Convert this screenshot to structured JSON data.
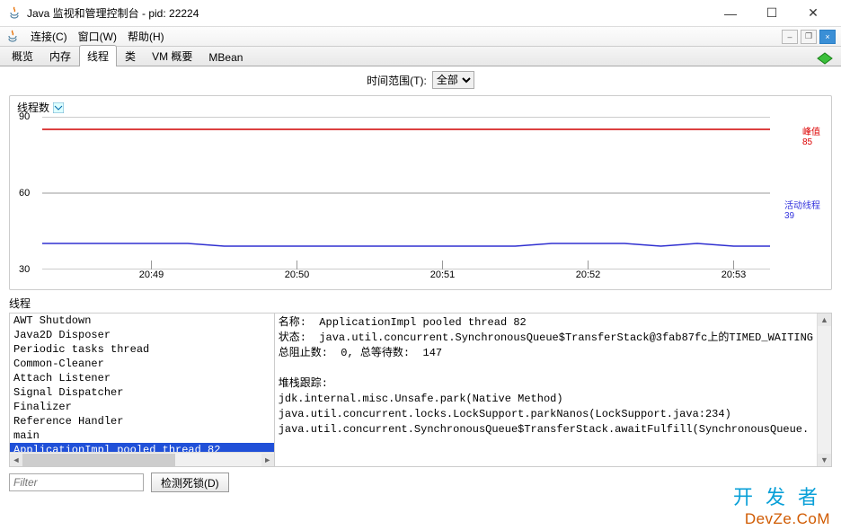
{
  "window": {
    "title": "Java 监视和管理控制台 - pid: 22224"
  },
  "menu": {
    "connect": "连接(C)",
    "window": "窗口(W)",
    "help": "帮助(H)"
  },
  "tabs": {
    "overview": "概览",
    "memory": "内存",
    "threads": "线程",
    "classes": "类",
    "vm": "VM 概要",
    "mbean": "MBean",
    "active": "threads"
  },
  "range": {
    "label": "时间范围(T):",
    "selected": "全部",
    "options": [
      "全部"
    ]
  },
  "chart_data": {
    "type": "line",
    "title": "线程数",
    "xlabel": "",
    "ylabel": "",
    "ylim": [
      30,
      90
    ],
    "yticks": [
      30,
      60,
      90
    ],
    "xticks": [
      "20:49",
      "20:50",
      "20:51",
      "20:52",
      "20:53"
    ],
    "series": [
      {
        "name": "峰值",
        "value_label": "85",
        "color": "#d00000",
        "values": [
          85,
          85,
          85,
          85,
          85,
          85,
          85,
          85,
          85,
          85,
          85,
          85,
          85,
          85,
          85,
          85,
          85,
          85,
          85,
          85
        ]
      },
      {
        "name": "活动线程",
        "value_label": "39",
        "color": "#3030d0",
        "values": [
          40,
          40,
          40,
          40,
          40,
          40,
          39,
          39,
          39,
          39,
          39,
          39,
          39,
          40,
          40,
          39,
          40,
          40,
          39,
          39
        ]
      }
    ]
  },
  "threads_section_label": "线程",
  "thread_list": {
    "items": [
      "AWT Shutdown",
      "Java2D Disposer",
      "Periodic tasks thread",
      "Common-Cleaner",
      "Attach Listener",
      "Signal Dispatcher",
      "Finalizer",
      "Reference Handler",
      "main",
      "ApplicationImpl pooled thread 82"
    ],
    "selected_index": 9
  },
  "detail": {
    "name_label": "名称:",
    "name_value": "ApplicationImpl pooled thread 82",
    "state_label": "状态:",
    "state_value": "java.util.concurrent.SynchronousQueue$TransferStack@3fab87fc上的TIMED_WAITING",
    "block_label": "总阻止数:",
    "block_value": "0",
    "wait_label": "总等待数:",
    "wait_value": "147",
    "stack_label": "堆栈跟踪:",
    "stack": [
      "jdk.internal.misc.Unsafe.park(Native Method)",
      "java.util.concurrent.locks.LockSupport.parkNanos(LockSupport.java:234)",
      "java.util.concurrent.SynchronousQueue$TransferStack.awaitFulfill(SynchronousQueue."
    ]
  },
  "filter": {
    "placeholder": "Filter"
  },
  "buttons": {
    "deadlock": "检测死锁(D)"
  },
  "watermark": {
    "line1": "开发者",
    "line2": "DevZe.CoM"
  }
}
